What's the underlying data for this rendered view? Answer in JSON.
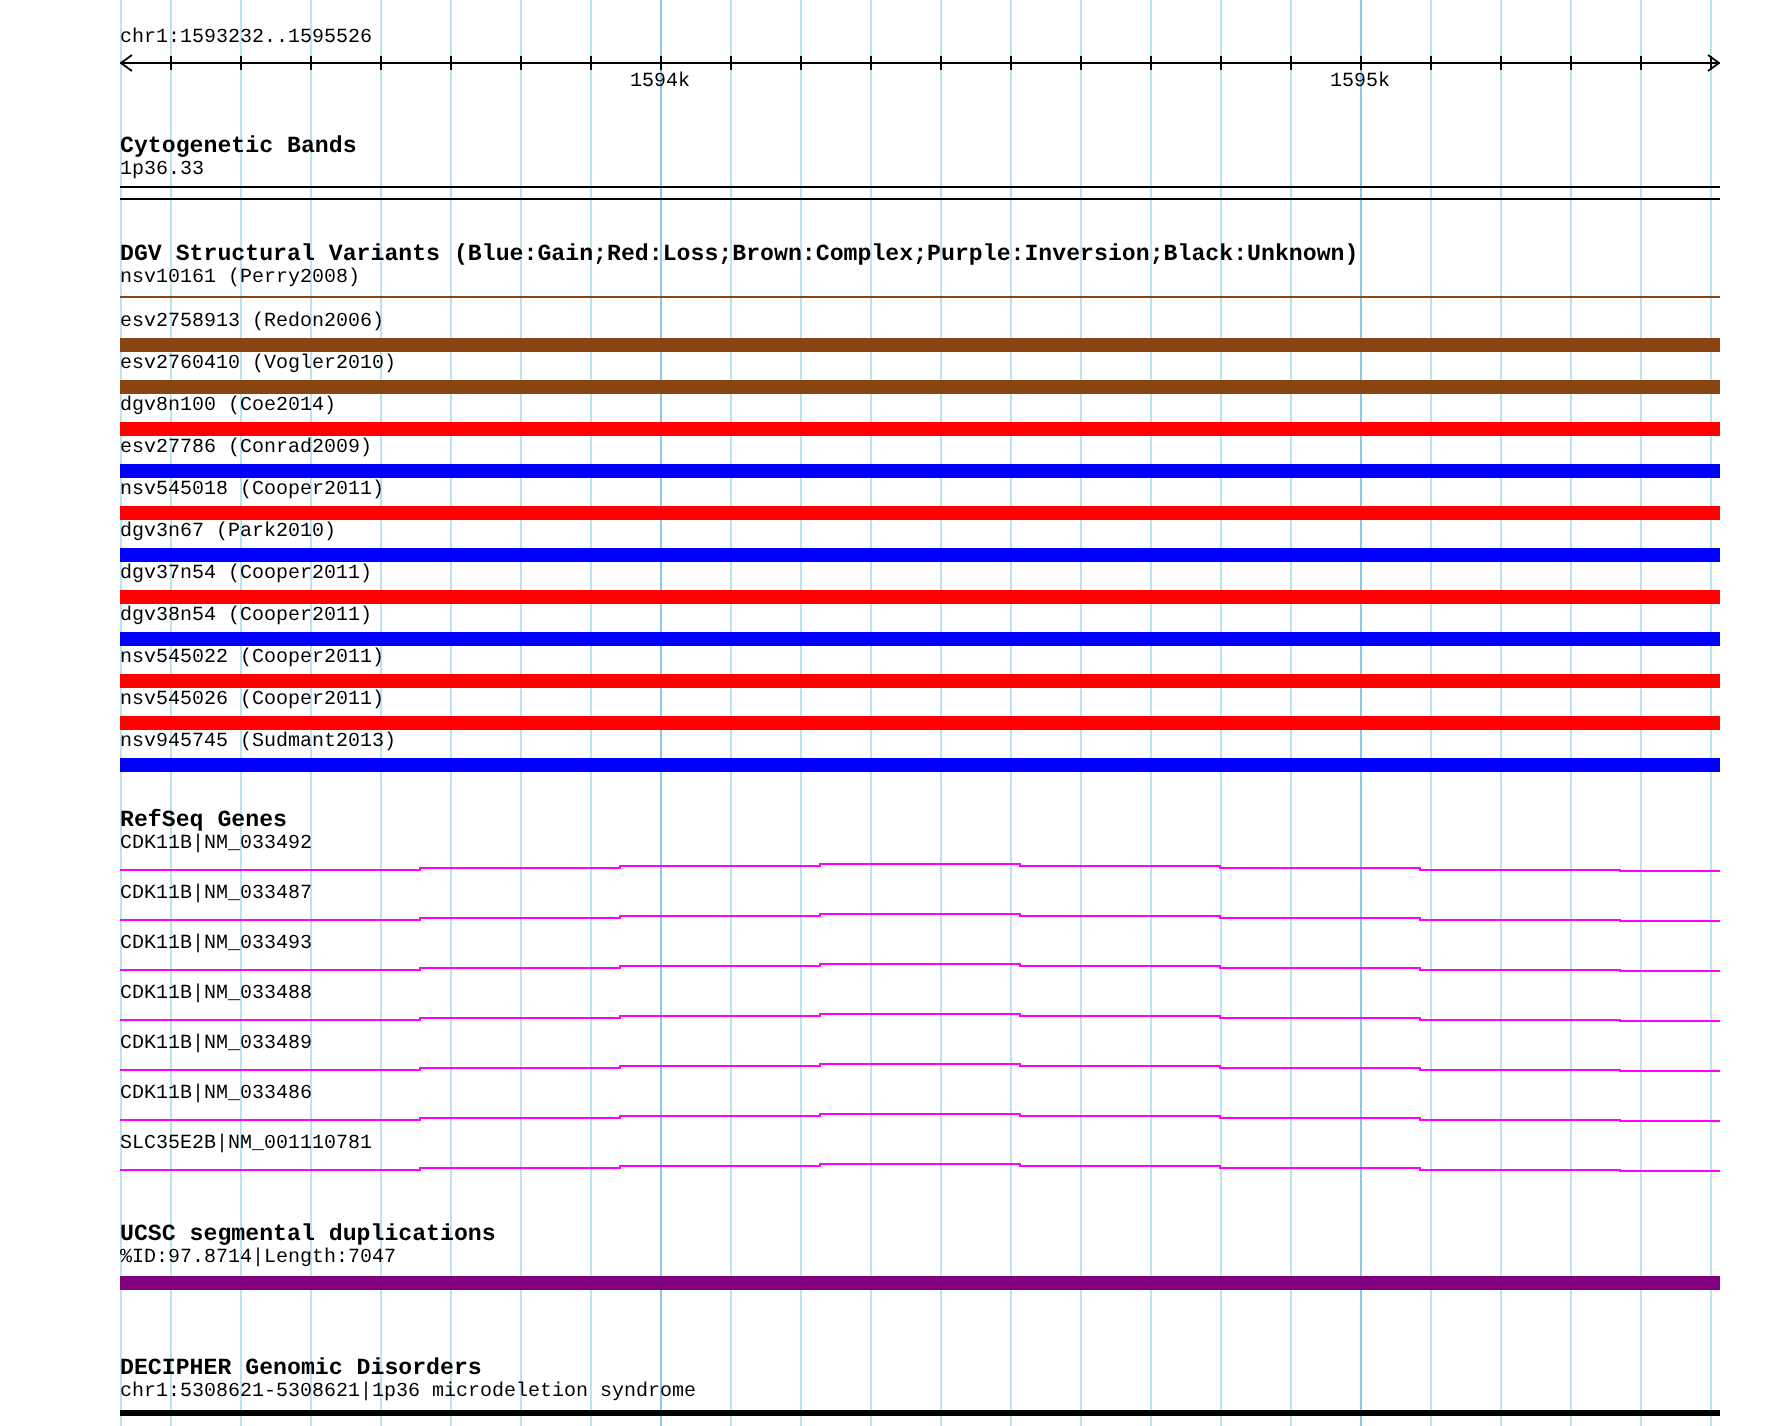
{
  "ruler": {
    "label": "chr1:1593232..1595526",
    "ticks": [
      "1594k",
      "1595k"
    ]
  },
  "tracks": [
    {
      "kind": "bands",
      "title": "Cytogenetic Bands",
      "features": [
        {
          "label": "1p36.33"
        }
      ]
    },
    {
      "kind": "variants",
      "title": "DGV Structural Variants (Blue:Gain;Red:Loss;Brown:Complex;Purple:Inversion;Black:Unknown)",
      "features": [
        {
          "label": "nsv10161 (Perry2008)",
          "kind": "line",
          "color": "#8b4513"
        },
        {
          "label": "esv2758913 (Redon2006)",
          "kind": "bar",
          "color": "#8b4513"
        },
        {
          "label": "esv2760410 (Vogler2010)",
          "kind": "bar",
          "color": "#8b4513"
        },
        {
          "label": "dgv8n100 (Coe2014)",
          "kind": "bar",
          "color": "#ff0000"
        },
        {
          "label": "esv27786 (Conrad2009)",
          "kind": "bar",
          "color": "#0000ff"
        },
        {
          "label": "nsv545018 (Cooper2011)",
          "kind": "bar",
          "color": "#ff0000"
        },
        {
          "label": "dgv3n67 (Park2010)",
          "kind": "bar",
          "color": "#0000ff"
        },
        {
          "label": "dgv37n54 (Cooper2011)",
          "kind": "bar",
          "color": "#ff0000"
        },
        {
          "label": "dgv38n54 (Cooper2011)",
          "kind": "bar",
          "color": "#0000ff"
        },
        {
          "label": "nsv545022 (Cooper2011)",
          "kind": "bar",
          "color": "#ff0000"
        },
        {
          "label": "nsv545026 (Cooper2011)",
          "kind": "bar",
          "color": "#ff0000"
        },
        {
          "label": "nsv945745 (Sudmant2013)",
          "kind": "bar",
          "color": "#0000ff"
        }
      ]
    },
    {
      "kind": "genes",
      "title": "RefSeq Genes",
      "features": [
        {
          "label": "CDK11B|NM_033492"
        },
        {
          "label": "CDK11B|NM_033487"
        },
        {
          "label": "CDK11B|NM_033493"
        },
        {
          "label": "CDK11B|NM_033488"
        },
        {
          "label": "CDK11B|NM_033489"
        },
        {
          "label": "CDK11B|NM_033486"
        },
        {
          "label": "SLC35E2B|NM_001110781"
        }
      ]
    },
    {
      "kind": "segdups",
      "title": "UCSC segmental duplications",
      "features": [
        {
          "label": "%ID:97.8714|Length:7047"
        }
      ]
    },
    {
      "kind": "disorders",
      "title": "DECIPHER Genomic Disorders",
      "features": [
        {
          "label": "chr1:5308621-5308621|1p36 microdeletion syndrome"
        }
      ]
    }
  ]
}
